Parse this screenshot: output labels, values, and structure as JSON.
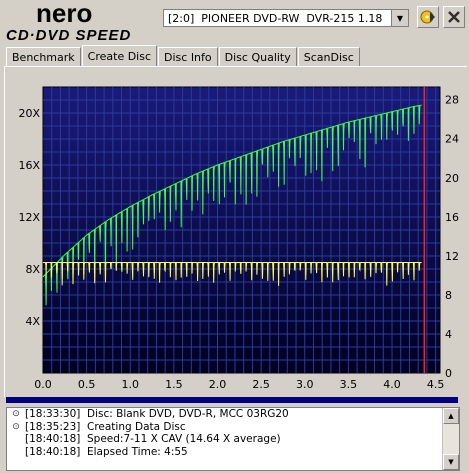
{
  "app": {
    "logo_top": "nero",
    "logo_bottom": "CD·DVD SPEED"
  },
  "toolbar": {
    "drive_value": "[2:0]  PIONEER DVD-RW  DVR-215 1.18",
    "icons": [
      "disc-eject-icon",
      "exit-icon"
    ]
  },
  "tabs": [
    {
      "label": "Benchmark"
    },
    {
      "label": "Create Disc"
    },
    {
      "label": "Disc Info"
    },
    {
      "label": "Disc Quality"
    },
    {
      "label": "ScanDisc"
    }
  ],
  "active_tab": "Create Disc",
  "colors": {
    "plot_top": "#1a1a7a",
    "plot_bottom": "#000020",
    "grid": "#2a3aa0",
    "speed": "#40ff40",
    "rpm": "#ffff40",
    "end_marker": "#ff2020"
  },
  "chart_data": {
    "type": "line",
    "x_label_values": [
      "0.0",
      "0.5",
      "1.0",
      "1.5",
      "2.0",
      "2.5",
      "3.0",
      "3.5",
      "4.0",
      "4.5"
    ],
    "x_range": [
      0,
      4.55
    ],
    "y_left_ticks": [
      "4X",
      "8X",
      "12X",
      "16X",
      "20X"
    ],
    "y_left_range": [
      0,
      22
    ],
    "y_right_ticks": [
      "0",
      "4",
      "8",
      "12",
      "16",
      "20",
      "24",
      "28"
    ],
    "y_right_range": [
      0,
      29.3
    ],
    "grid": true,
    "end_position": 4.37,
    "series": [
      {
        "key": "speed",
        "x": [
          0.0,
          0.25,
          0.5,
          0.75,
          1.0,
          1.25,
          1.5,
          1.75,
          2.0,
          2.25,
          2.5,
          2.75,
          3.0,
          3.25,
          3.5,
          3.75,
          4.0,
          4.25,
          4.34
        ],
        "values": [
          7.4,
          9.1,
          10.6,
          11.8,
          12.8,
          13.7,
          14.5,
          15.3,
          16.0,
          16.6,
          17.2,
          17.8,
          18.3,
          18.8,
          19.3,
          19.7,
          20.1,
          20.5,
          20.6
        ],
        "dip_depth": 3.5
      },
      {
        "key": "rpm",
        "x": [
          0.0,
          4.34
        ],
        "values": [
          8.5,
          8.5
        ],
        "dip_depth": 1.5
      }
    ]
  },
  "log": [
    {
      "icon": "info-icon",
      "time": "[18:33:30]",
      "text": "Disc: Blank DVD, DVD-R, MCC 03RG20"
    },
    {
      "icon": "info-icon",
      "time": "[18:35:23]",
      "text": "Creating Data Disc"
    },
    {
      "icon": "",
      "time": "[18:40:18]",
      "text": "Speed:7-11 X CAV (14.64 X average)"
    },
    {
      "icon": "",
      "time": "[18:40:18]",
      "text": "Elapsed Time:  4:55"
    }
  ]
}
